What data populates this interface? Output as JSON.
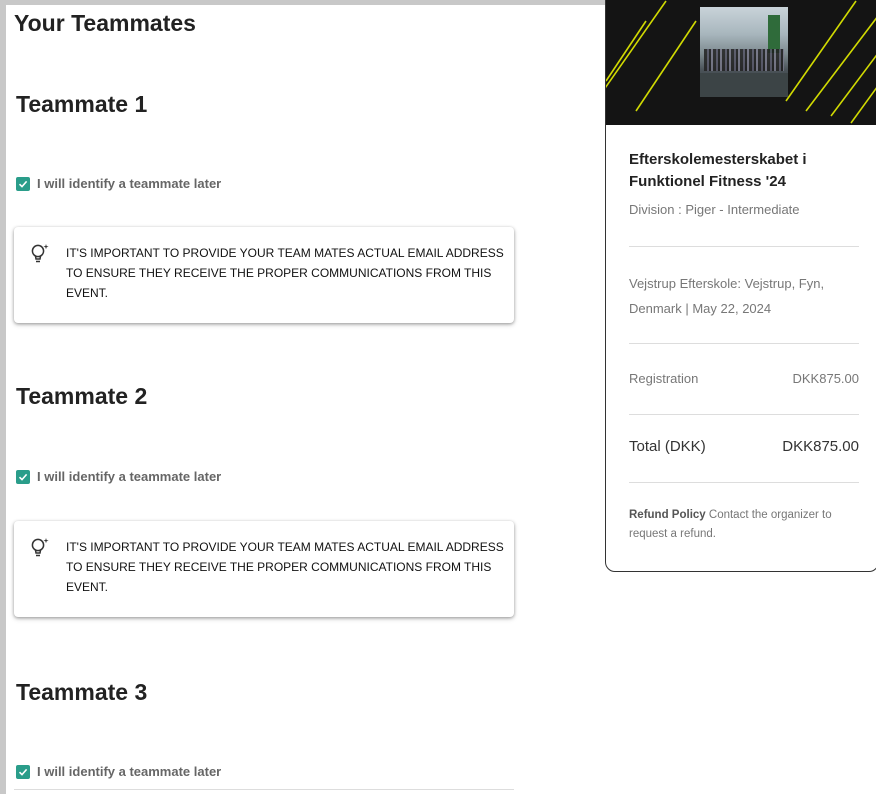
{
  "page": {
    "section_title": "Your Teammates"
  },
  "teammates": [
    {
      "heading": "Teammate 1",
      "checkbox_label": "I will identify a teammate later",
      "checked": true,
      "notice": "IT'S IMPORTANT TO PROVIDE YOUR TEAM MATES ACTUAL EMAIL ADDRESS TO ENSURE THEY RECEIVE THE PROPER COMMUNICATIONS FROM THIS EVENT."
    },
    {
      "heading": "Teammate 2",
      "checkbox_label": "I will identify a teammate later",
      "checked": true,
      "notice": "IT'S IMPORTANT TO PROVIDE YOUR TEAM MATES ACTUAL EMAIL ADDRESS TO ENSURE THEY RECEIVE THE PROPER COMMUNICATIONS FROM THIS EVENT."
    },
    {
      "heading": "Teammate 3",
      "checkbox_label": "I will identify a teammate later",
      "checked": true
    }
  ],
  "icons": {
    "notice": "lightbulb-icon",
    "checkbox": "checkmark-icon"
  },
  "event_card": {
    "title": "Efterskolemesterskabet i Funktionel Fitness '24",
    "division": "Division : Piger - Intermediate",
    "location": "Vejstrup Efterskole: Vejstrup, Fyn, Denmark | May 22, 2024",
    "registration_label": "Registration",
    "registration_value": "DKK875.00",
    "total_label": "Total (DKK)",
    "total_value": "DKK875.00",
    "refund_title": "Refund Policy",
    "refund_text": "Contact the organizer to request a refund."
  },
  "colors": {
    "checkbox": "#2a9d8a",
    "banner_background": "#141414",
    "banner_stripes": "#e6f000"
  }
}
